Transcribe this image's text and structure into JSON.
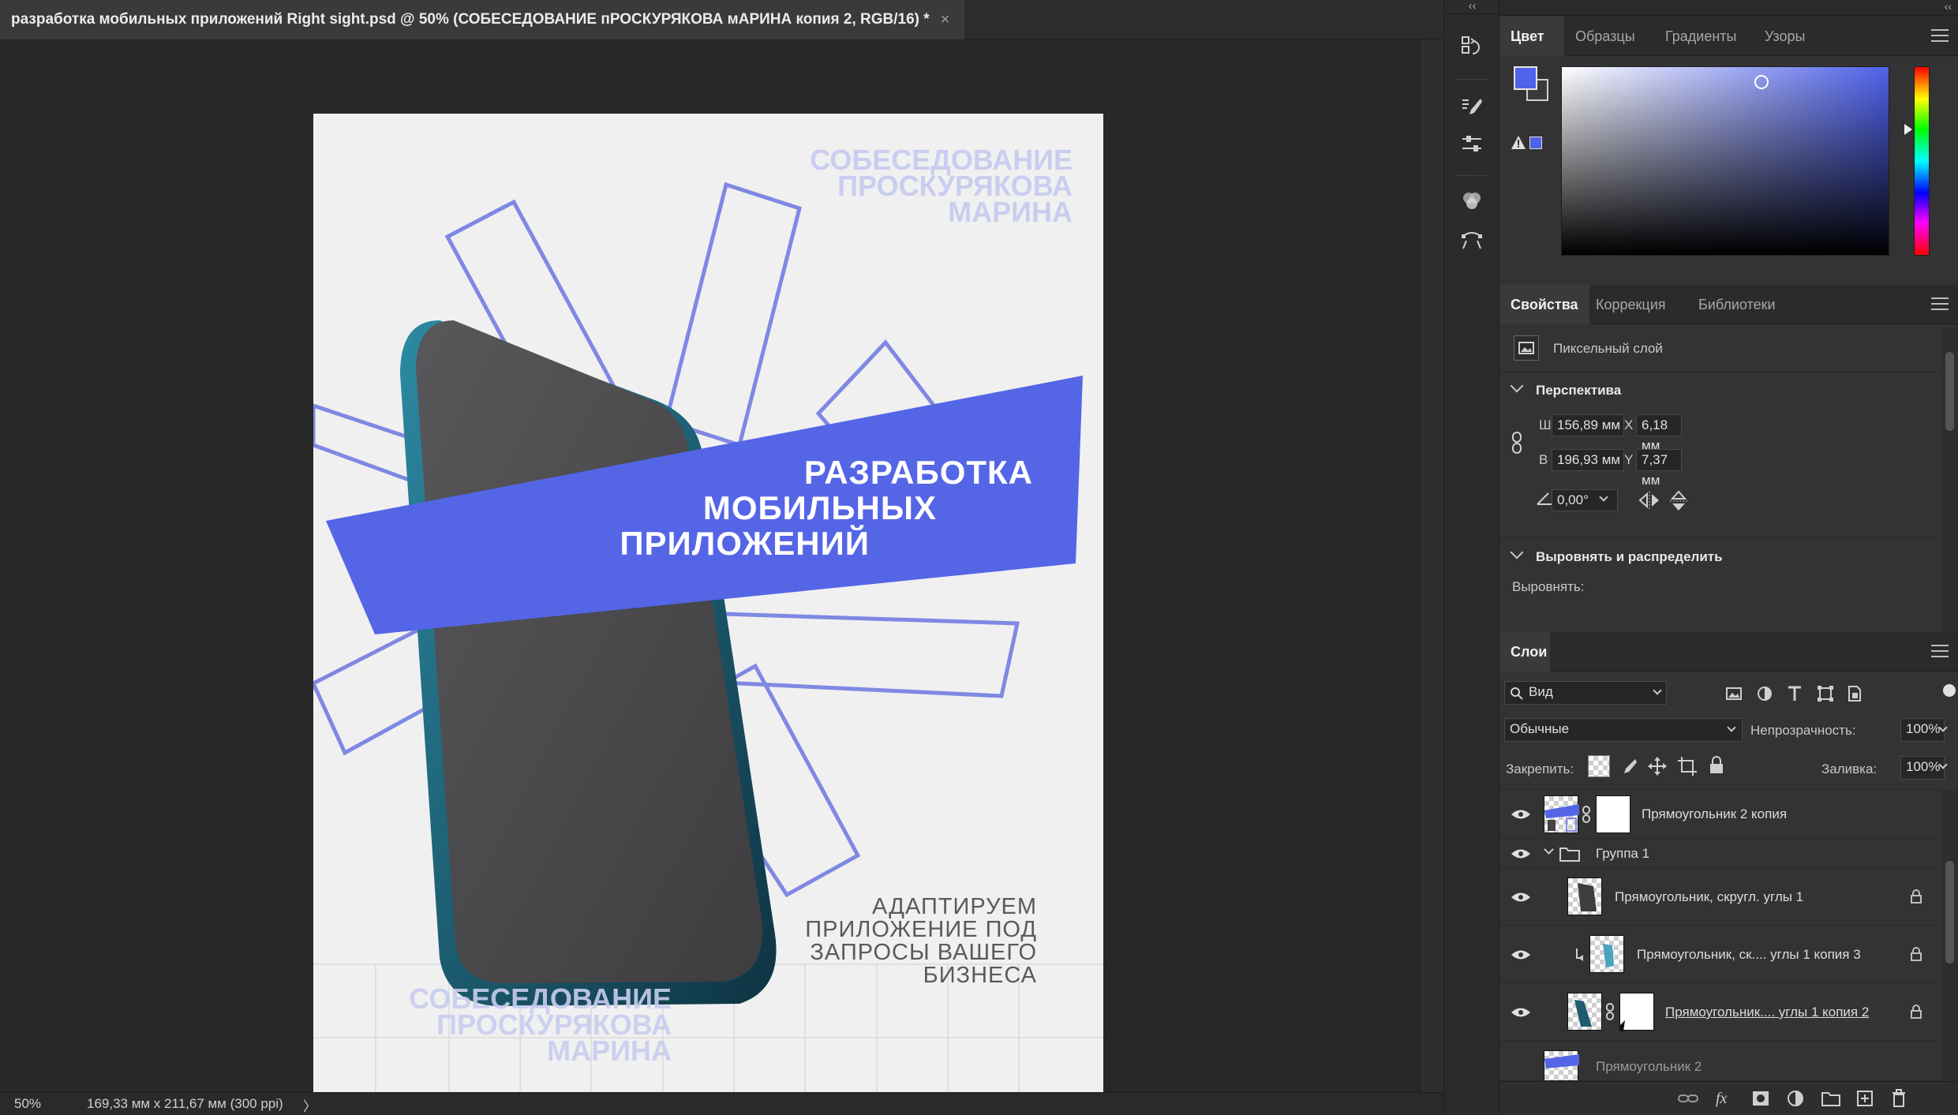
{
  "document": {
    "tab_title": "разработка мобильных приложений Right sight.psd @ 50% (СОБЕСЕДОВАНИЕ пРОСКУРЯКОВА мАРИНА копия 2, RGB/16) *",
    "close_symbol": "×"
  },
  "artwork": {
    "top_name": [
      "СОБЕСЕДОВАНИЕ",
      "ПРОСКУРЯКОВА",
      "МАРИНА"
    ],
    "banner": [
      "РАЗРАБОТКА",
      "МОБИЛЬНЫХ",
      "ПРИЛОЖЕНИЙ"
    ],
    "tagline": [
      "АДАПТИРУЕМ",
      "ПРИЛОЖЕНИЕ ПОД",
      "ЗАПРОСЫ ВАШЕГО",
      "БИЗНЕСА"
    ],
    "bottom_name": [
      "СОБЕСЕДОВАНИЕ",
      "ПРОСКУРЯКОВА",
      "МАРИНА"
    ],
    "colors": {
      "accent": "#5465e6",
      "accent_outline": "#7f88e2",
      "name_tint": "#c9cdef",
      "phone_body": "#4a4849",
      "phone_edge": "#1f5a6e",
      "paper": "#f0f0f0"
    }
  },
  "status": {
    "zoom": "50%",
    "doc_size": "169,33 мм х 211,67 мм (300 ppi)",
    "arrow": "〉"
  },
  "toolstrip": {
    "collapse": "‹‹",
    "tools": [
      "history-icon",
      "brush-settings-icon",
      "adjust-brush-icon",
      "channels-icon",
      "paths-icon"
    ]
  },
  "color_panel": {
    "tabs": [
      "Цвет",
      "Образцы",
      "Градиенты",
      "Узоры"
    ],
    "foreground": "#4f62ea",
    "background": "#3a3a3a",
    "swatch_warn": "#4f62ea"
  },
  "properties_panel": {
    "tabs": [
      "Свойства",
      "Коррекция",
      "Библиотеки"
    ],
    "layer_kind": "Пиксельный слой",
    "section_perspective": "Перспектива",
    "w_label": "Ш",
    "w_value": "156,89 мм",
    "h_label": "В",
    "h_value": "196,93 мм",
    "x_label": "X",
    "x_value": "6,18 мм",
    "y_label": "Y",
    "y_value": "7,37 мм",
    "angle_value": "0,00°",
    "section_align": "Выровнять и распределить",
    "align_label": "Выровнять:"
  },
  "layers_panel": {
    "tab": "Слои",
    "filter_kind": "Вид",
    "blend_mode": "Обычные",
    "opacity_label": "Непрозрачность:",
    "opacity_value": "100%",
    "lock_label": "Закрепить:",
    "fill_label": "Заливка:",
    "fill_value": "100%",
    "layers": [
      {
        "name": "Прямоугольник 2 копия"
      },
      {
        "name": "Группа 1"
      },
      {
        "name": "Прямоугольник, скругл. углы 1"
      },
      {
        "name": "Прямоугольник, ск.... углы 1 копия 3"
      },
      {
        "name": "Прямоугольник.... углы 1 копия 2"
      },
      {
        "name": "Прямоугольник 2"
      }
    ]
  }
}
